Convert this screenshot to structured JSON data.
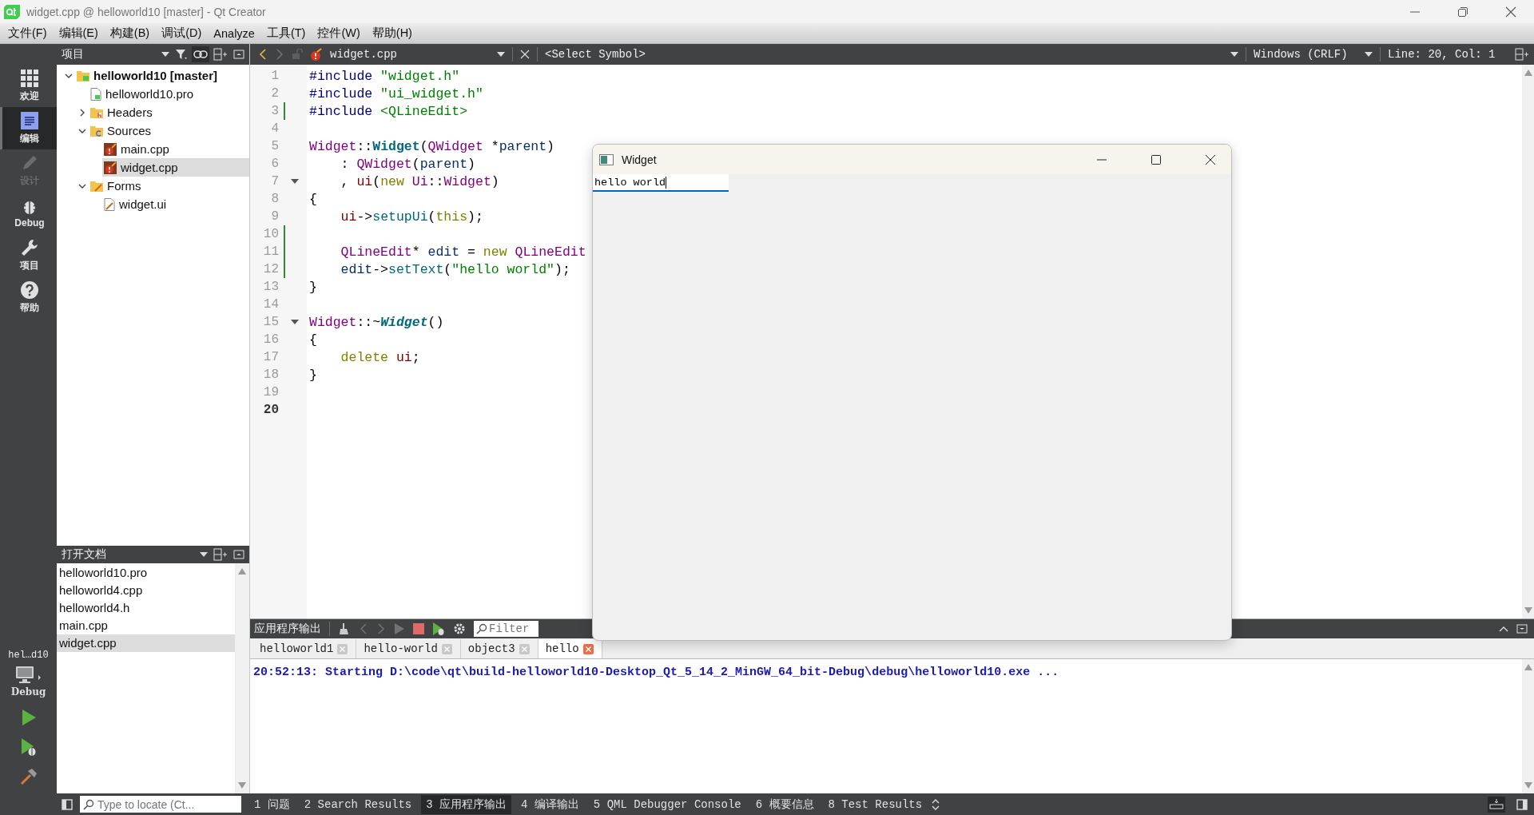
{
  "window": {
    "title": "widget.cpp @ helloworld10 [master] - Qt Creator"
  },
  "menu": [
    "文件(F)",
    "编辑(E)",
    "构建(B)",
    "调试(D)",
    "Analyze",
    "工具(T)",
    "控件(W)",
    "帮助(H)"
  ],
  "modes": [
    {
      "label": "欢迎",
      "kind": "welcome",
      "selected": false,
      "disabled": false
    },
    {
      "label": "编辑",
      "kind": "edit",
      "selected": true,
      "disabled": false
    },
    {
      "label": "设计",
      "kind": "design",
      "selected": false,
      "disabled": true
    },
    {
      "label": "Debug",
      "kind": "debug",
      "selected": false,
      "disabled": false
    },
    {
      "label": "项目",
      "kind": "projects",
      "selected": false,
      "disabled": false
    },
    {
      "label": "帮助",
      "kind": "help",
      "selected": false,
      "disabled": false
    }
  ],
  "kit": {
    "project": "hel…d10",
    "config": "Debug"
  },
  "project_pane": {
    "title": "项目",
    "tree": [
      {
        "label": "helloworld10 [master]",
        "kind": "project",
        "expanded": true,
        "selected": false,
        "children": [
          {
            "label": "helloworld10.pro",
            "kind": "pro",
            "selected": false
          },
          {
            "label": "Headers",
            "kind": "headers",
            "expanded": false,
            "selected": false
          },
          {
            "label": "Sources",
            "kind": "sources",
            "expanded": true,
            "selected": false,
            "children": [
              {
                "label": "main.cpp",
                "kind": "cpp",
                "selected": false
              },
              {
                "label": "widget.cpp",
                "kind": "cpp",
                "selected": true
              }
            ]
          },
          {
            "label": "Forms",
            "kind": "forms",
            "expanded": true,
            "selected": false,
            "children": [
              {
                "label": "widget.ui",
                "kind": "ui",
                "selected": false
              }
            ]
          }
        ]
      }
    ]
  },
  "open_documents": {
    "title": "打开文档",
    "items": [
      {
        "label": "helloworld10.pro",
        "selected": false
      },
      {
        "label": "helloworld4.cpp",
        "selected": false
      },
      {
        "label": "helloworld4.h",
        "selected": false
      },
      {
        "label": "main.cpp",
        "selected": false
      },
      {
        "label": "widget.cpp",
        "selected": true
      }
    ]
  },
  "editor": {
    "file": "widget.cpp",
    "symbol": "<Select Symbol>",
    "line_ending": "Windows (CRLF)",
    "position": "Line: 20, Col: 1",
    "lines": [
      {
        "number": "1",
        "current": false,
        "modified": false,
        "foldable": false,
        "tokens": [
          {
            "kind": "directive",
            "text": "#include"
          },
          {
            "kind": "string",
            "text": " \"widget.h\""
          }
        ]
      },
      {
        "number": "2",
        "current": false,
        "modified": false,
        "foldable": false,
        "tokens": [
          {
            "kind": "directive",
            "text": "#include"
          },
          {
            "kind": "string",
            "text": " \"ui_widget.h\""
          }
        ]
      },
      {
        "number": "3",
        "current": false,
        "modified": true,
        "foldable": false,
        "tokens": [
          {
            "kind": "directive",
            "text": "#include"
          },
          {
            "kind": "string",
            "text": " <QLineEdit>"
          }
        ]
      },
      {
        "number": "4",
        "current": false,
        "modified": false,
        "foldable": false
      },
      {
        "number": "5",
        "current": false,
        "modified": false,
        "foldable": false,
        "tokens": [
          {
            "kind": "type",
            "text": "Widget"
          },
          {
            "kind": "plain",
            "text": "::"
          },
          {
            "kind": "function_def",
            "text": "Widget"
          },
          {
            "kind": "plain",
            "text": "("
          },
          {
            "kind": "type",
            "text": "QWidget"
          },
          {
            "kind": "plain",
            "text": " *"
          },
          {
            "kind": "param",
            "text": "parent"
          },
          {
            "kind": "plain",
            "text": ")"
          }
        ]
      },
      {
        "number": "6",
        "current": false,
        "modified": false,
        "foldable": false,
        "tokens": [
          {
            "kind": "plain",
            "text": "    :"
          },
          {
            "kind": "type",
            "text": " QWidget"
          },
          {
            "kind": "plain",
            "text": "("
          },
          {
            "kind": "param",
            "text": "parent"
          },
          {
            "kind": "plain",
            "text": ")"
          }
        ]
      },
      {
        "number": "7",
        "current": false,
        "modified": false,
        "foldable": true,
        "tokens": [
          {
            "kind": "plain",
            "text": "    ,"
          },
          {
            "kind": "member",
            "text": " ui"
          },
          {
            "kind": "plain",
            "text": "("
          },
          {
            "kind": "keyword",
            "text": "new"
          },
          {
            "kind": "type",
            "text": " Ui"
          },
          {
            "kind": "plain",
            "text": "::"
          },
          {
            "kind": "type",
            "text": "Widget"
          },
          {
            "kind": "plain",
            "text": ")"
          }
        ]
      },
      {
        "number": "8",
        "current": false,
        "modified": false,
        "foldable": false,
        "tokens": [
          {
            "kind": "plain",
            "text": "{"
          }
        ]
      },
      {
        "number": "9",
        "current": false,
        "modified": false,
        "foldable": false,
        "tokens": [
          {
            "kind": "member",
            "text": "    ui"
          },
          {
            "kind": "plain",
            "text": "->"
          },
          {
            "kind": "function",
            "text": "setupUi"
          },
          {
            "kind": "plain",
            "text": "("
          },
          {
            "kind": "keyword",
            "text": "this"
          },
          {
            "kind": "plain",
            "text": ");"
          }
        ]
      },
      {
        "number": "10",
        "current": false,
        "modified": true,
        "foldable": false
      },
      {
        "number": "11",
        "current": false,
        "modified": true,
        "foldable": false,
        "tokens": [
          {
            "kind": "type",
            "text": "    QLineEdit"
          },
          {
            "kind": "plain",
            "text": "*"
          },
          {
            "kind": "local",
            "text": " edit"
          },
          {
            "kind": "plain",
            "text": " ="
          },
          {
            "kind": "keyword",
            "text": " new"
          },
          {
            "kind": "type",
            "text": " QLineEdit"
          }
        ]
      },
      {
        "number": "12",
        "current": false,
        "modified": true,
        "foldable": false,
        "tokens": [
          {
            "kind": "local",
            "text": "    edit"
          },
          {
            "kind": "plain",
            "text": "->"
          },
          {
            "kind": "function",
            "text": "setText"
          },
          {
            "kind": "plain",
            "text": "("
          },
          {
            "kind": "string",
            "text": "\"hello world\""
          },
          {
            "kind": "plain",
            "text": ");"
          }
        ]
      },
      {
        "number": "13",
        "current": false,
        "modified": false,
        "foldable": false,
        "tokens": [
          {
            "kind": "plain",
            "text": "}"
          }
        ]
      },
      {
        "number": "14",
        "current": false,
        "modified": false,
        "foldable": false
      },
      {
        "number": "15",
        "current": false,
        "modified": false,
        "foldable": true,
        "tokens": [
          {
            "kind": "type",
            "text": "Widget"
          },
          {
            "kind": "plain",
            "text": "::~"
          },
          {
            "kind": "destructor",
            "text": "Widget"
          },
          {
            "kind": "plain",
            "text": "()"
          }
        ]
      },
      {
        "number": "16",
        "current": false,
        "modified": false,
        "foldable": false,
        "tokens": [
          {
            "kind": "plain",
            "text": "{"
          }
        ]
      },
      {
        "number": "17",
        "current": false,
        "modified": false,
        "foldable": false,
        "tokens": [
          {
            "kind": "keyword",
            "text": "    delete"
          },
          {
            "kind": "member",
            "text": " ui"
          },
          {
            "kind": "plain",
            "text": ";"
          }
        ]
      },
      {
        "number": "18",
        "current": false,
        "modified": false,
        "foldable": false,
        "tokens": [
          {
            "kind": "plain",
            "text": "}"
          }
        ]
      },
      {
        "number": "19",
        "current": false,
        "modified": false,
        "foldable": false
      },
      {
        "number": "20",
        "current": true,
        "modified": false,
        "foldable": false
      }
    ]
  },
  "app_window": {
    "title": "Widget",
    "line_edit": {
      "value": "hello world",
      "focused": true
    }
  },
  "output": {
    "title": "应用程序输出",
    "filter": {
      "placeholder": "Filter"
    },
    "tabs": [
      {
        "label": "helloworld1",
        "selected": false
      },
      {
        "label": "hello-world",
        "selected": false
      },
      {
        "label": "object3",
        "selected": false
      },
      {
        "label": "hello",
        "selected": true
      }
    ],
    "lines": [
      "20:52:13: Starting D:\\code\\qt\\build-helloworld10-Desktop_Qt_5_14_2_MinGW_64_bit-Debug\\debug\\helloworld10.exe ..."
    ]
  },
  "status_bar": {
    "locate": {
      "placeholder": "Type to locate (Ct..."
    },
    "panes": [
      {
        "label": "1 问题",
        "selected": false
      },
      {
        "label": "2 Search Results",
        "selected": false
      },
      {
        "label": "3 应用程序输出",
        "selected": true
      },
      {
        "label": "4 编译输出",
        "selected": false
      },
      {
        "label": "5 QML Debugger Console",
        "selected": false
      },
      {
        "label": "6 概要信息",
        "selected": false
      },
      {
        "label": "8 Test Results",
        "selected": false
      }
    ]
  }
}
